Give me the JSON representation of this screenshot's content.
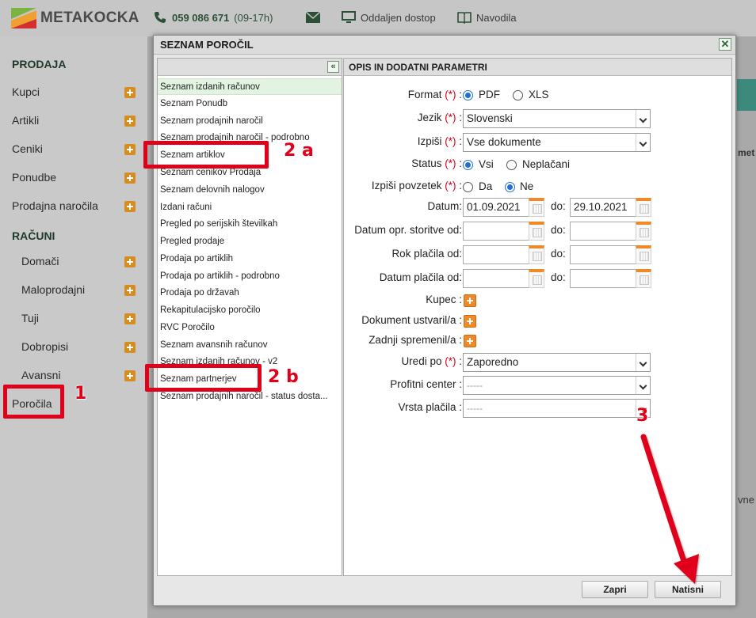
{
  "header": {
    "brand": "METAKOCKA",
    "phone": "059 086 671",
    "phone_hours": "(09-17h)",
    "remote": "Oddaljen dostop",
    "manual": "Navodila"
  },
  "sidebar": {
    "sec_sales": "PRODAJA",
    "sales_items": [
      "Kupci",
      "Artikli",
      "Ceniki",
      "Ponudbe",
      "Prodajna naročila"
    ],
    "sec_invoices": "RAČUNI",
    "invoice_items": [
      "Domači",
      "Maloprodajni",
      "Tuji",
      "Dobropisi",
      "Avansni"
    ],
    "reports": "Poročila"
  },
  "background_partial": {
    "top_right": "met",
    "bottom_right": "vne"
  },
  "modal": {
    "title": "SEZNAM POROČIL",
    "close": "✕",
    "collapse": "«",
    "right_title": "OPIS IN DODATNI PARAMETRI",
    "reports": [
      "Seznam izdanih računov",
      "Seznam Ponudb",
      "Seznam prodajnih naročil",
      "Seznam prodajnih naročil - podrobno",
      "Seznam artiklov",
      "Seznam cenikov Prodaja",
      "Seznam delovnih nalogov",
      "Izdani računi",
      "Pregled po serijskih številkah",
      "Pregled prodaje",
      "Prodaja po artiklih",
      "Prodaja po artiklih - podrobno",
      "Prodaja po državah",
      "Rekapitulacijsko poročilo",
      "RVC Poročilo",
      "Seznam avansnih računov",
      "Seznam izdanih računov - v2",
      "Seznam partnerjev",
      "Seznam prodajnih naročil - status dosta..."
    ],
    "form": {
      "required_mark": "(*)",
      "format_label": "Format",
      "format_options": [
        "PDF",
        "XLS"
      ],
      "format_selected": "PDF",
      "jezik_label": "Jezik",
      "jezik_value": "Slovenski",
      "izpisi_label": "Izpiši",
      "izpisi_value": "Vse dokumente",
      "status_label": "Status",
      "status_options": [
        "Vsi",
        "Neplačani"
      ],
      "status_selected": "Vsi",
      "povzetek_label": "Izpiši povzetek",
      "povzetek_options": [
        "Da",
        "Ne"
      ],
      "povzetek_selected": "Ne",
      "datum_label": "Datum:",
      "datum_from": "01.09.2021",
      "to_label": "do:",
      "datum_to": "29.10.2021",
      "storitve_label": "Datum opr. storitve od:",
      "rok_label": "Rok plačila od:",
      "placila_label": "Datum plačila od:",
      "kupec_label": "Kupec :",
      "ustvaril_label": "Dokument ustvaril/a :",
      "spremenil_label": "Zadnji spremenil/a :",
      "uredi_label": "Uredi po",
      "uredi_value": "Zaporedno",
      "profit_label": "Profitni center :",
      "profit_value": "-----",
      "vrsta_label": "Vrsta plačila :",
      "vrsta_value": "-----"
    },
    "buttons": {
      "close": "Zapri",
      "print": "Natisni"
    }
  },
  "annotations": {
    "n1": "1",
    "n2a": "2 a",
    "n2b": "2 b",
    "n3": "3",
    "color": "#e0001a"
  }
}
